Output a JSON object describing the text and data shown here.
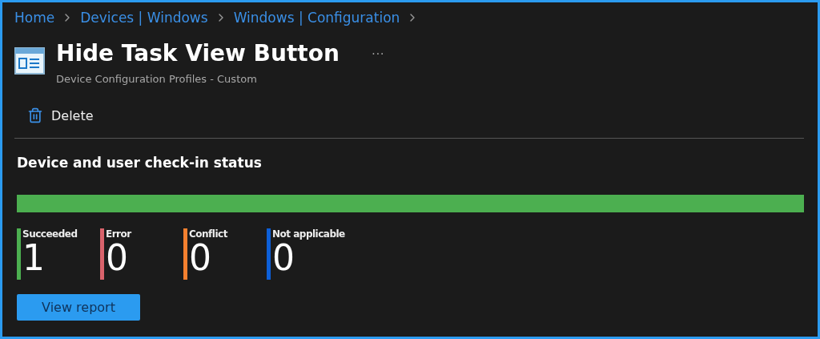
{
  "breadcrumb": [
    "Home",
    "Devices | Windows",
    "Windows | Configuration"
  ],
  "header": {
    "title": "Hide Task View Button",
    "more": "···",
    "subtitle": "Device Configuration Profiles - Custom"
  },
  "toolbar": [
    {
      "label": "Delete"
    }
  ],
  "status": {
    "title": "Device and user check-in status",
    "progress": {
      "level": 1,
      "color": "#4caf50"
    },
    "stats": [
      {
        "label": "Succeeded",
        "value": "1",
        "color": "#4caf50"
      },
      {
        "label": "Error",
        "value": "0",
        "color": "#d9636c"
      },
      {
        "label": "Conflict",
        "value": "0",
        "color": "#f4802f"
      },
      {
        "label": "Not applicable",
        "value": "0",
        "color": "#0d5fd8"
      }
    ],
    "button": "View report"
  }
}
